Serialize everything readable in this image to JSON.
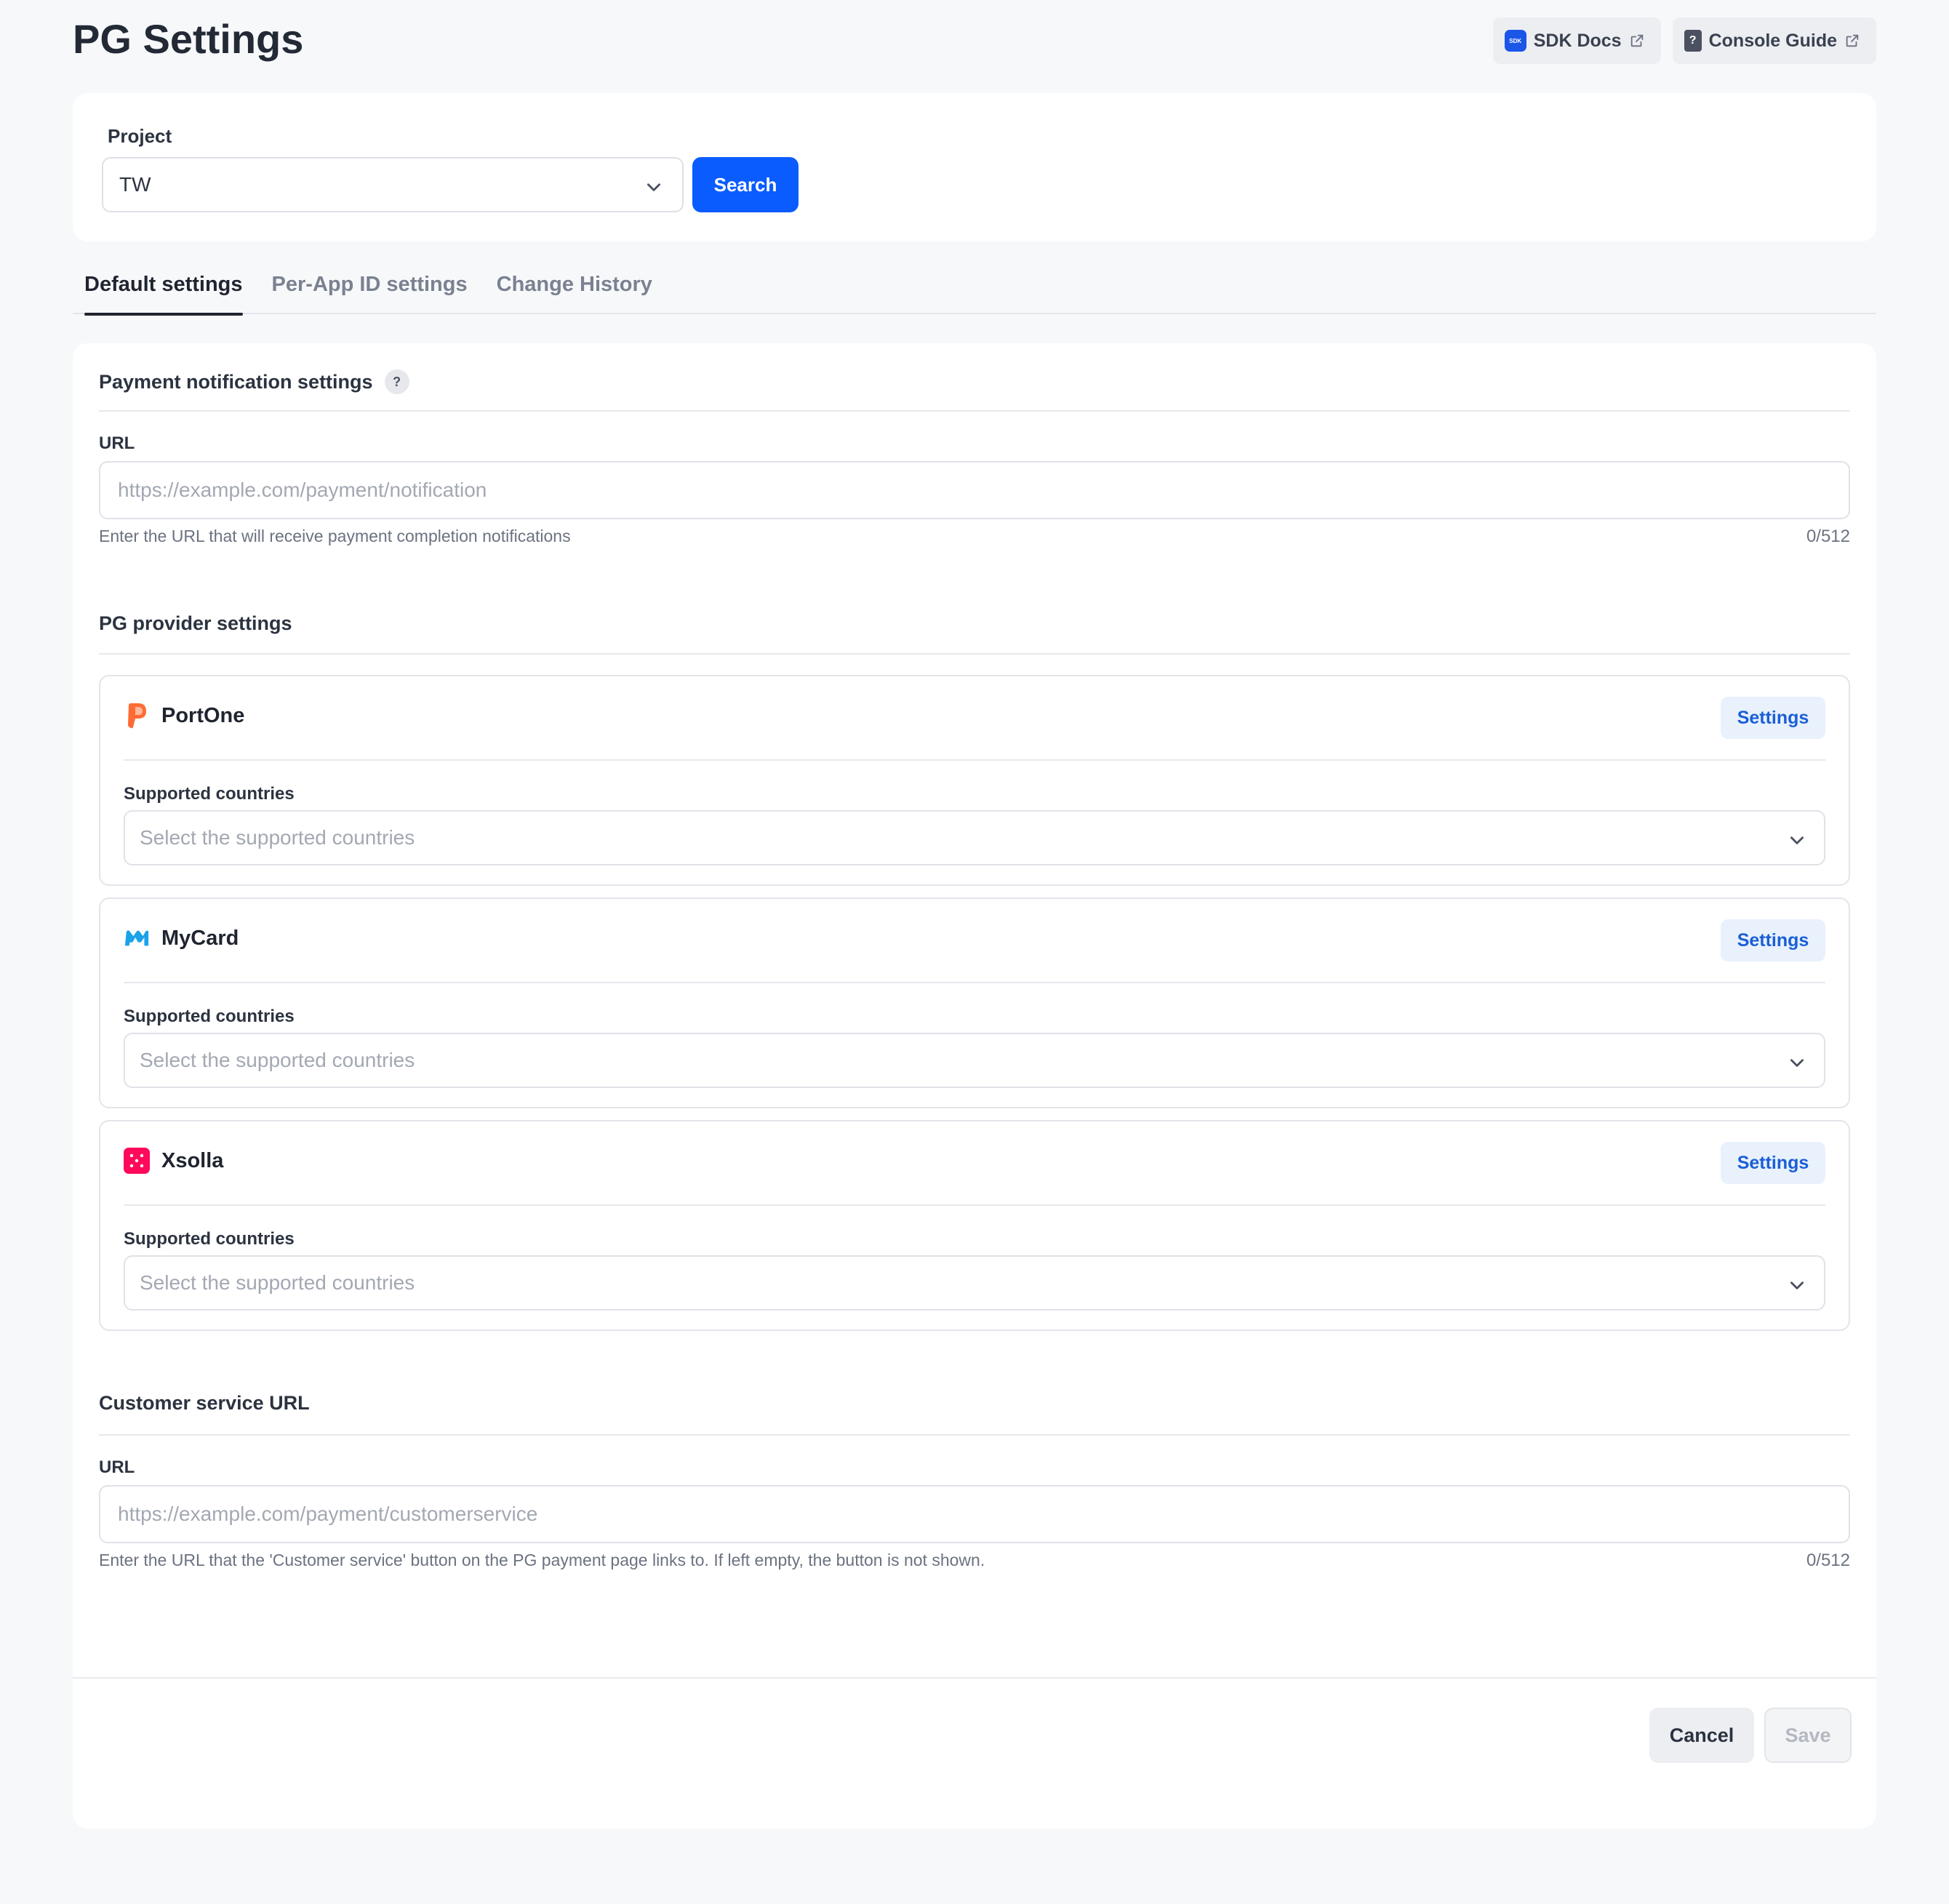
{
  "header": {
    "title": "PG Settings",
    "links": [
      {
        "label": "SDK Docs",
        "icon": "sdk-doc-icon",
        "badge": "SDK"
      },
      {
        "label": "Console Guide",
        "icon": "guide-doc-icon",
        "badge": "?"
      }
    ]
  },
  "project": {
    "label": "Project",
    "selected": "TW",
    "search_label": "Search"
  },
  "tabs": [
    {
      "label": "Default settings",
      "active": true
    },
    {
      "label": "Per-App ID settings",
      "active": false
    },
    {
      "label": "Change History",
      "active": false
    }
  ],
  "payment_notification": {
    "title": "Payment notification settings",
    "help_glyph": "?",
    "url_label": "URL",
    "placeholder": "https://example.com/payment/notification",
    "value": "",
    "helper": "Enter the URL that will receive payment completion notifications",
    "counter": "0/512"
  },
  "pg_providers": {
    "title": "PG provider settings",
    "items": [
      {
        "name": "PortOne",
        "logo": "portone-logo-icon",
        "settings_label": "Settings",
        "countries_label": "Supported countries",
        "countries_placeholder": "Select the supported countries"
      },
      {
        "name": "MyCard",
        "logo": "mycard-logo-icon",
        "settings_label": "Settings",
        "countries_label": "Supported countries",
        "countries_placeholder": "Select the supported countries"
      },
      {
        "name": "Xsolla",
        "logo": "xsolla-logo-icon",
        "settings_label": "Settings",
        "countries_label": "Supported countries",
        "countries_placeholder": "Select the supported countries"
      }
    ]
  },
  "customer_service": {
    "title": "Customer service URL",
    "url_label": "URL",
    "placeholder": "https://example.com/payment/customerservice",
    "value": "",
    "helper": "Enter the URL that the 'Customer service' button on the PG payment page links to. If left empty, the button is not shown.",
    "counter": "0/512"
  },
  "footer": {
    "cancel_label": "Cancel",
    "save_label": "Save"
  },
  "colors": {
    "primary": "#0a5cff",
    "settings_button_bg": "#e9f1fd",
    "settings_button_text": "#1a5fd6",
    "portone_brand": "#ff6b35",
    "mycard_brand": "#1aa3e8",
    "xsolla_brand": "#ff0a5a"
  }
}
